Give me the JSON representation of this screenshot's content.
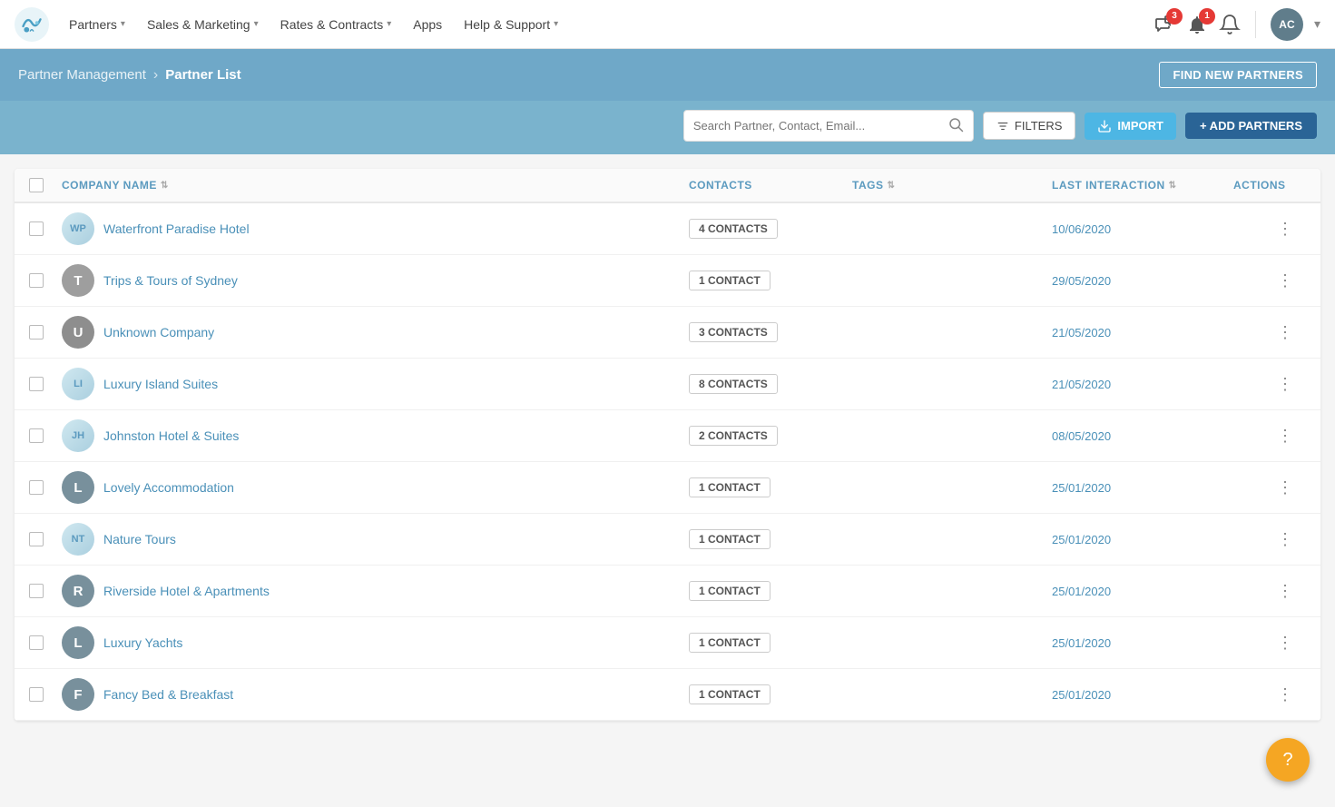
{
  "nav": {
    "items": [
      {
        "label": "Partners",
        "hasDropdown": true
      },
      {
        "label": "Sales & Marketing",
        "hasDropdown": true
      },
      {
        "label": "Rates & Contracts",
        "hasDropdown": true
      },
      {
        "label": "Apps",
        "hasDropdown": false
      },
      {
        "label": "Help & Support",
        "hasDropdown": true
      }
    ],
    "notifications": {
      "messages_badge": "3",
      "alerts_badge": "1"
    },
    "user_initials": "AC"
  },
  "breadcrumb": {
    "parent": "Partner Management",
    "separator": "›",
    "current": "Partner List"
  },
  "find_new_btn": "FIND NEW PARTNERS",
  "search": {
    "placeholder": "Search Partner, Contact, Email..."
  },
  "filters_btn": "FILTERS",
  "import_btn": "IMPORT",
  "add_partners_btn": "+ ADD PARTNERS",
  "table": {
    "columns": [
      {
        "label": "COMPANY NAME",
        "sortable": true
      },
      {
        "label": "CONTACTS",
        "sortable": false
      },
      {
        "label": "TAGS",
        "sortable": true
      },
      {
        "label": "LAST INTERACTION",
        "sortable": true
      },
      {
        "label": "ACTIONS",
        "sortable": false
      }
    ],
    "rows": [
      {
        "id": 1,
        "name": "Waterfront Paradise Hotel",
        "contacts": "4 CONTACTS",
        "tags": "",
        "last_interaction": "10/06/2020",
        "avatar_type": "img",
        "avatar_color": "#ccc",
        "avatar_label": "WP"
      },
      {
        "id": 2,
        "name": "Trips & Tours of Sydney",
        "contacts": "1 CONTACT",
        "tags": "",
        "last_interaction": "29/05/2020",
        "avatar_type": "letter",
        "avatar_color": "#9e9e9e",
        "avatar_label": "T"
      },
      {
        "id": 3,
        "name": "Unknown Company",
        "contacts": "3 CONTACTS",
        "tags": "",
        "last_interaction": "21/05/2020",
        "avatar_type": "letter",
        "avatar_color": "#8e8e8e",
        "avatar_label": "U"
      },
      {
        "id": 4,
        "name": "Luxury Island Suites",
        "contacts": "8 CONTACTS",
        "tags": "",
        "last_interaction": "21/05/2020",
        "avatar_type": "img",
        "avatar_color": "#ccc",
        "avatar_label": "LI"
      },
      {
        "id": 5,
        "name": "Johnston Hotel & Suites",
        "contacts": "2 CONTACTS",
        "tags": "",
        "last_interaction": "08/05/2020",
        "avatar_type": "img",
        "avatar_color": "#ccc",
        "avatar_label": "JH"
      },
      {
        "id": 6,
        "name": "Lovely Accommodation",
        "contacts": "1 CONTACT",
        "tags": "",
        "last_interaction": "25/01/2020",
        "avatar_type": "letter",
        "avatar_color": "#78909c",
        "avatar_label": "L"
      },
      {
        "id": 7,
        "name": "Nature Tours",
        "contacts": "1 CONTACT",
        "tags": "",
        "last_interaction": "25/01/2020",
        "avatar_type": "img",
        "avatar_color": "#ccc",
        "avatar_label": "NT"
      },
      {
        "id": 8,
        "name": "Riverside Hotel & Apartments",
        "contacts": "1 CONTACT",
        "tags": "",
        "last_interaction": "25/01/2020",
        "avatar_type": "letter",
        "avatar_color": "#78909c",
        "avatar_label": "R"
      },
      {
        "id": 9,
        "name": "Luxury Yachts",
        "contacts": "1 CONTACT",
        "tags": "",
        "last_interaction": "25/01/2020",
        "avatar_type": "letter",
        "avatar_color": "#78909c",
        "avatar_label": "L"
      },
      {
        "id": 10,
        "name": "Fancy Bed & Breakfast",
        "contacts": "1 CONTACT",
        "tags": "",
        "last_interaction": "25/01/2020",
        "avatar_type": "letter",
        "avatar_color": "#78909c",
        "avatar_label": "F"
      }
    ]
  },
  "fab": {
    "icon": "?",
    "label": "help-fab"
  }
}
